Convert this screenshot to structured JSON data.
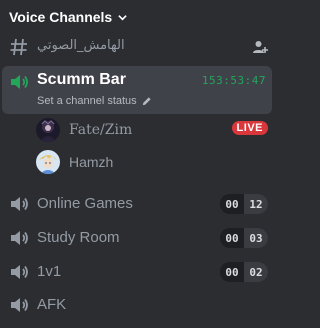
{
  "category": {
    "title": "Voice Channels",
    "chevron_icon": "chevron-down-icon"
  },
  "text_channel": {
    "name": "الهامش_الصوتي",
    "icon": "hashtag-icon",
    "action_icon": "add-user-icon"
  },
  "active_channel": {
    "name": "Scumm Bar",
    "status_placeholder": "Set a channel status",
    "status_icon": "pencil-icon",
    "timer": "153:53:47",
    "icon": "speaker-active-icon",
    "users": [
      {
        "name": "Fate/Zim",
        "badge": "LIVE"
      },
      {
        "name": "Hamzh",
        "badge": ""
      }
    ]
  },
  "channels": [
    {
      "name": "Online Games",
      "current": "00",
      "max": "12"
    },
    {
      "name": "Study Room",
      "current": "00",
      "max": "03"
    },
    {
      "name": "1v1",
      "current": "00",
      "max": "02"
    },
    {
      "name": "AFK",
      "current": "",
      "max": ""
    }
  ],
  "colors": {
    "background": "#2b2d31",
    "selected": "#404249",
    "timer": "#23a55a",
    "live": "#da373c"
  }
}
